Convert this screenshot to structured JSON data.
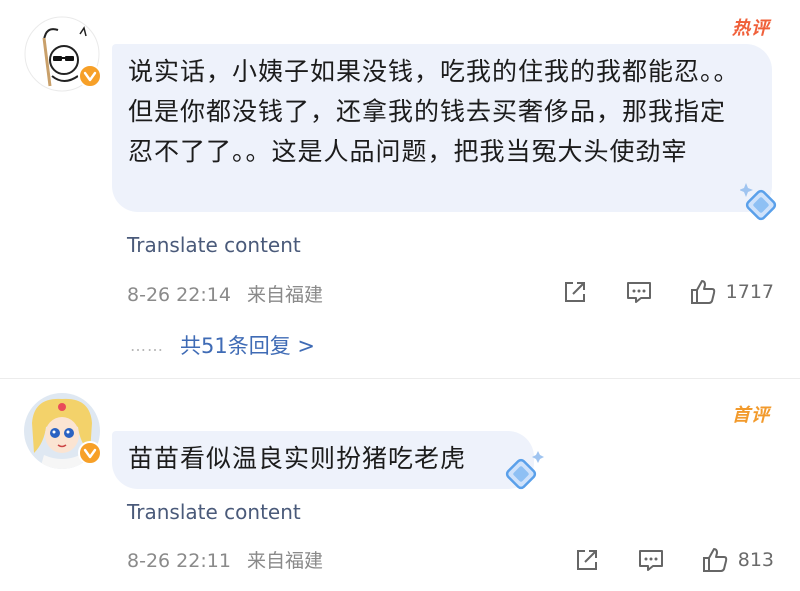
{
  "comments": [
    {
      "tag": "热评",
      "text": "说实话，小姨子如果没钱，吃我的住我的我都能忍。。但是你都没钱了，还拿我的钱去买奢侈品，那我指定忍不了了。。这是人品问题，把我当冤大头使劲宰",
      "translate_label": "Translate content",
      "date": "8-26 22:14",
      "location": "来自福建",
      "like_count": "1717",
      "replies_label": "共51条回复 >",
      "replies_dots": "……"
    },
    {
      "tag": "首评",
      "text": "苗苗看似温良实则扮猪吃老虎",
      "translate_label": "Translate content",
      "date": "8-26 22:11",
      "location": "来自福建",
      "like_count": "813"
    }
  ],
  "icons": {
    "share": "share-icon",
    "comment": "comment-icon",
    "like": "thumbs-up-icon",
    "badge": "verified-badge-icon",
    "gem": "diamond-gem-icon"
  },
  "colors": {
    "bubble": "#eef2fb",
    "link": "#3f6bb5",
    "hot_tag": "#f0603a",
    "first_tag": "#f29a2c",
    "badge": "#f7a028"
  }
}
